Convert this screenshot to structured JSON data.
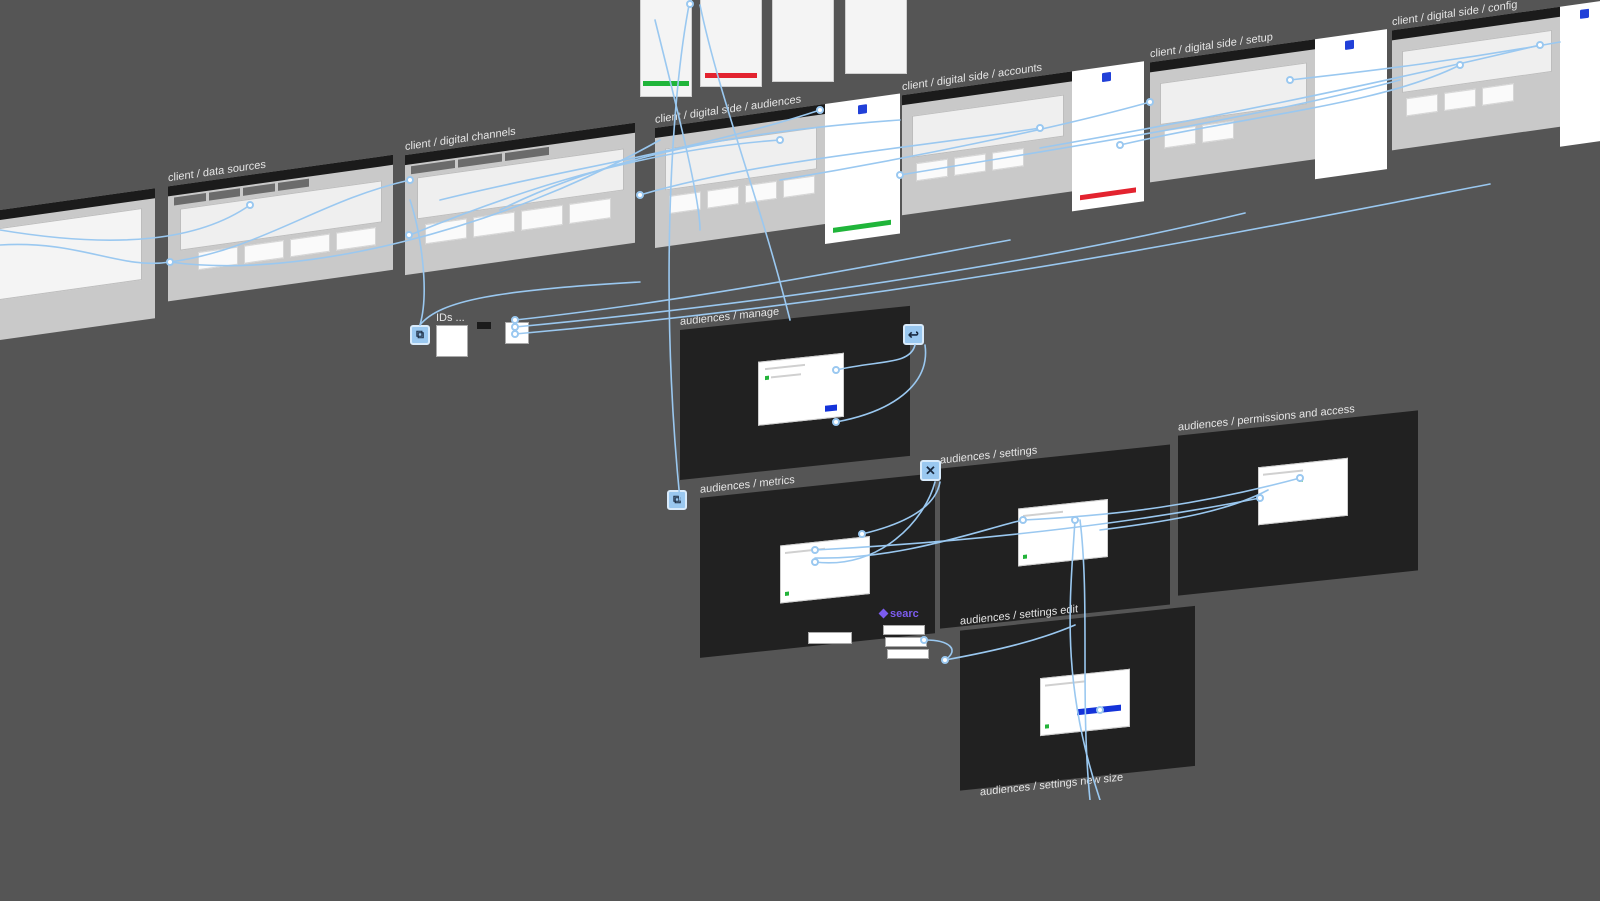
{
  "frames": {
    "data_sources": "client / data sources",
    "digital_channels": "client / digital channels",
    "digital_side_audiences": "client / digital side / audiences",
    "digital_side_accounts": "client / digital side / accounts",
    "digital_side_setup": "client / digital side / setup",
    "digital_side_config": "client / digital side / config",
    "audiences_manage": "audiences / manage",
    "audiences_metrics": "audiences / metrics",
    "audiences_settings": "audiences / settings",
    "audiences_permissions": "audiences / permissions and access",
    "audiences_settings_edit": "audiences / settings edit",
    "audiences_settings_new": "audiences / settings new size"
  },
  "labels": {
    "ids": "IDs ...",
    "search": "searc"
  },
  "nodes": {
    "back_glyph": "↩",
    "close_glyph": "✕",
    "device_glyph": "⧉"
  },
  "colors": {
    "canvas": "#555555",
    "wire": "#9ac8f0",
    "dark_frame": "#212121",
    "accent_blue": "#1433d9",
    "ok_green": "#20b53a",
    "danger_red": "#e3232f"
  }
}
